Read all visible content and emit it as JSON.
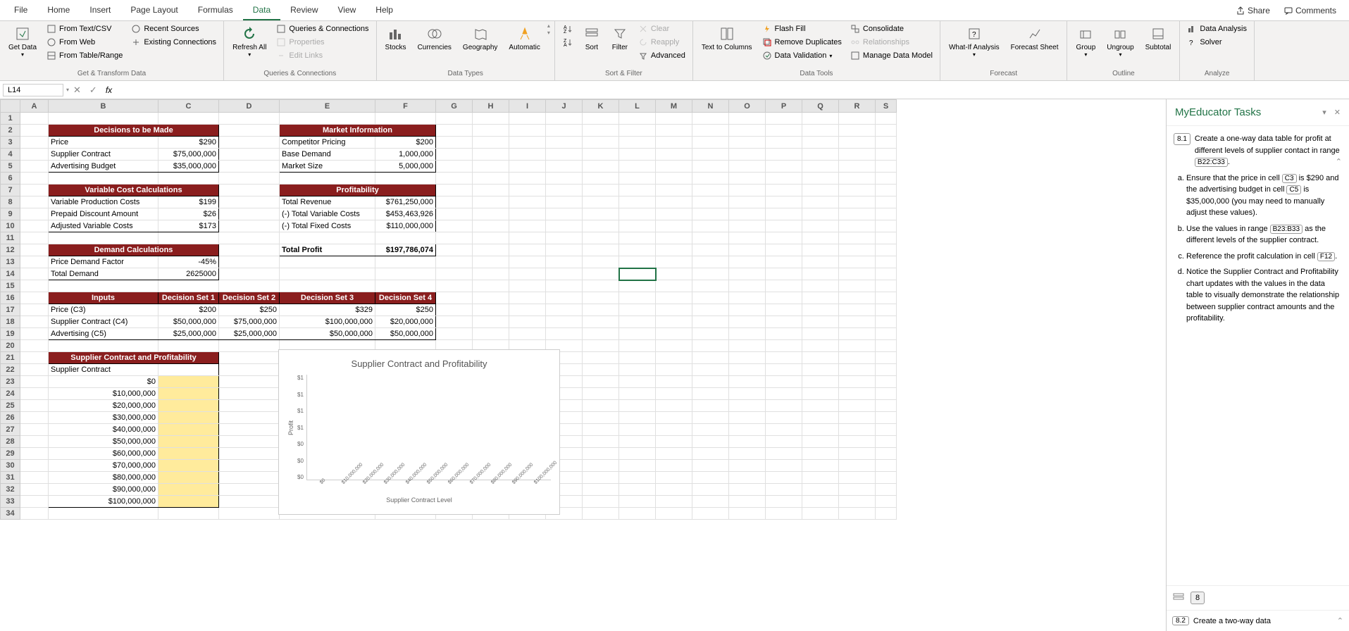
{
  "ribbon": {
    "tabs": [
      "File",
      "Home",
      "Insert",
      "Page Layout",
      "Formulas",
      "Data",
      "Review",
      "View",
      "Help"
    ],
    "active_tab": "Data",
    "share": "Share",
    "comments": "Comments",
    "groups": {
      "get_data": {
        "btn": "Get Data",
        "items": [
          "From Text/CSV",
          "From Web",
          "From Table/Range",
          "Recent Sources",
          "Existing Connections"
        ],
        "label": "Get & Transform Data"
      },
      "queries": {
        "btn": "Refresh All",
        "items": [
          "Queries & Connections",
          "Properties",
          "Edit Links"
        ],
        "label": "Queries & Connections"
      },
      "types": {
        "items": [
          "Stocks",
          "Currencies",
          "Geography",
          "Automatic"
        ],
        "label": "Data Types"
      },
      "sort": {
        "sort": "Sort",
        "filter": "Filter",
        "clear": "Clear",
        "reapply": "Reapply",
        "advanced": "Advanced",
        "label": "Sort & Filter"
      },
      "tools": {
        "ttc": "Text to Columns",
        "items": [
          "Flash Fill",
          "Remove Duplicates",
          "Data Validation",
          "Consolidate",
          "Relationships",
          "Manage Data Model"
        ],
        "label": "Data Tools"
      },
      "forecast": {
        "whatif": "What-If Analysis",
        "sheet": "Forecast Sheet",
        "label": "Forecast"
      },
      "outline": {
        "group": "Group",
        "ungroup": "Ungroup",
        "subtotal": "Subtotal",
        "label": "Outline"
      },
      "analyze": {
        "items": [
          "Data Analysis",
          "Solver"
        ],
        "label": "Analyze"
      }
    }
  },
  "namebox": "L14",
  "formula": "",
  "columns": [
    "A",
    "B",
    "C",
    "D",
    "E",
    "F",
    "G",
    "H",
    "I",
    "J",
    "K",
    "L",
    "M",
    "N",
    "O",
    "P",
    "Q",
    "R",
    "S"
  ],
  "col_widths": {
    "A": 40,
    "B": 156,
    "C": 86,
    "D": 86,
    "E": 136,
    "F": 86,
    "G": 52,
    "H": 52,
    "I": 52,
    "J": 52,
    "K": 52,
    "L": 52,
    "M": 52,
    "N": 52,
    "O": 52,
    "P": 52,
    "Q": 52,
    "R": 52,
    "S": 30
  },
  "rows": 34,
  "cells": {
    "decisions_hdr": "Decisions to be Made",
    "price": "Price",
    "price_v": "$290",
    "supplier": "Supplier Contract",
    "supplier_v": "$75,000,000",
    "adv": "Advertising Budget",
    "adv_v": "$35,000,000",
    "market_hdr": "Market Information",
    "comp": "Competitor Pricing",
    "comp_v": "$200",
    "base": "Base Demand",
    "base_v": "1,000,000",
    "msize": "Market Size",
    "msize_v": "5,000,000",
    "varcost_hdr": "Variable Cost Calculations",
    "vpc": "Variable Production Costs",
    "vpc_v": "$199",
    "pda": "Prepaid Discount Amount",
    "pda_v": "$26",
    "avc": "Adjusted Variable Costs",
    "avc_v": "$173",
    "prof_hdr": "Profitability",
    "trev": "Total Revenue",
    "trev_v": "$761,250,000",
    "tvc": "(-) Total Variable Costs",
    "tvc_v": "$453,463,926",
    "tfc": "(-) Total Fixed Costs",
    "tfc_v": "$110,000,000",
    "tprofit": "Total Profit",
    "tprofit_v": "$197,786,074",
    "demand_hdr": "Demand Calculations",
    "pdf": "Price Demand Factor",
    "pdf_v": "-45%",
    "td": "Total Demand",
    "td_v": "2625000",
    "inputs": "Inputs",
    "ds1": "Decision Set 1",
    "ds2": "Decision Set 2",
    "ds3": "Decision Set 3",
    "ds4": "Decision Set 4",
    "r17a": "Price (C3)",
    "r17": [
      "$200",
      "$250",
      "$329",
      "$250"
    ],
    "r18a": "Supplier Contract (C4)",
    "r18": [
      "$50,000,000",
      "$75,000,000",
      "$100,000,000",
      "$20,000,000"
    ],
    "r19a": "Advertising (C5)",
    "r19": [
      "$25,000,000",
      "$25,000,000",
      "$50,000,000",
      "$50,000,000"
    ],
    "scp_hdr": "Supplier Contract and Profitability",
    "scp_lbl": "Supplier Contract",
    "scp_vals": [
      "$0",
      "$10,000,000",
      "$20,000,000",
      "$30,000,000",
      "$40,000,000",
      "$50,000,000",
      "$60,000,000",
      "$70,000,000",
      "$80,000,000",
      "$90,000,000",
      "$100,000,000"
    ]
  },
  "chart_data": {
    "type": "bar",
    "title": "Supplier Contract and Profitability",
    "xlabel": "Supplier Contract Level",
    "ylabel": "Profit",
    "categories": [
      "$0",
      "$10,000,000",
      "$20,000,000",
      "$30,000,000",
      "$40,000,000",
      "$50,000,000",
      "$60,000,000",
      "$70,000,000",
      "$80,000,000",
      "$90,000,000",
      "$100,000,000"
    ],
    "values": [
      0,
      0,
      0,
      0,
      0,
      0,
      0,
      0,
      0,
      0,
      0
    ],
    "y_ticks": [
      "$1",
      "$1",
      "$1",
      "$1",
      "$0",
      "$0",
      "$0"
    ]
  },
  "task_pane": {
    "title": "MyEducator Tasks",
    "task_num": "8.1",
    "intro": "Create a one-way data table for profit at different levels of supplier contact in range ",
    "intro_ref": "B22:C33",
    "items": [
      {
        "pre": "Ensure that the price in cell ",
        "ref1": "C3",
        "mid": " is $290 and the advertising budget in cell ",
        "ref2": "C5",
        "post": " is $35,000,000 (you may need to manually adjust these values)."
      },
      {
        "pre": "Use the values in range ",
        "ref1": "B23:B33",
        "post": " as the different levels of the supplier contract."
      },
      {
        "pre": "Reference the profit calculation in cell ",
        "ref1": "F12",
        "post": "."
      },
      {
        "pre": "Notice the Supplier Contract and Profitability chart updates with the values in the data table to visually demonstrate the relationship between supplier contract amounts and the profitability."
      }
    ],
    "footer_badge": "8",
    "next_num": "8.2",
    "next_text": "Create a two-way data"
  }
}
